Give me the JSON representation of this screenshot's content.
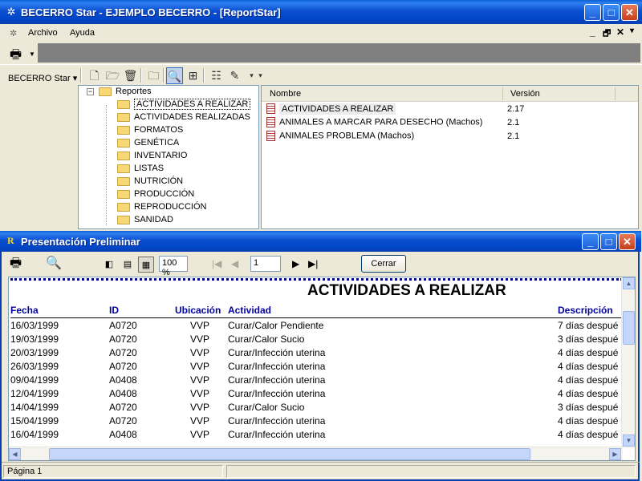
{
  "main_window": {
    "title": "BECERRO Star - EJEMPLO BECERRO - [ReportStar]",
    "controls": {
      "minimize": "_",
      "maximize": "□",
      "close": "✕"
    },
    "menu": [
      "Archivo",
      "Ayuda"
    ],
    "mdi_controls": {
      "minimize": "_",
      "restore": "🗗",
      "close": "✕",
      "dropdown": "▾"
    }
  },
  "toolbar": {
    "becerro_label": "BECERRO Star",
    "icons": [
      "new-icon",
      "open-folder-icon",
      "delete-icon",
      "new-folder-icon",
      "preview-icon",
      "design-icon",
      "properties-icon",
      "wizard-icon"
    ]
  },
  "tree": {
    "root": "Reportes",
    "folders": [
      "ACTIVIDADES A REALIZAR",
      "ACTIVIDADES REALIZADAS",
      "FORMATOS",
      "GENÉTICA",
      "INVENTARIO",
      "LISTAS",
      "NUTRICIÓN",
      "PRODUCCIÓN",
      "REPRODUCCIÓN",
      "SANIDAD"
    ],
    "selected_index": 0
  },
  "list": {
    "headers": {
      "name": "Nombre",
      "version": "Versión"
    },
    "rows": [
      {
        "name": "ACTIVIDADES A REALIZAR",
        "version": "2.17"
      },
      {
        "name": "ANIMALES A MARCAR PARA DESECHO (Machos)",
        "version": "2.1"
      },
      {
        "name": "ANIMALES PROBLEMA (Machos)",
        "version": "2.1"
      }
    ]
  },
  "preview": {
    "title": "Presentación Preliminar",
    "zoom": "100 %",
    "page": "1",
    "close_label": "Cerrar",
    "report_title": "ACTIVIDADES A REALIZAR",
    "columns": {
      "fecha": "Fecha",
      "id": "ID",
      "ubicacion": "Ubicación",
      "actividad": "Actividad",
      "descripcion": "Descripción"
    },
    "rows": [
      {
        "fecha": "16/03/1999",
        "id": "A0720",
        "ubicacion": "VVP",
        "actividad": "Curar/Calor Pendiente",
        "descripcion": "7 días despué"
      },
      {
        "fecha": "19/03/1999",
        "id": "A0720",
        "ubicacion": "VVP",
        "actividad": "Curar/Calor Sucio",
        "descripcion": "3 días despué"
      },
      {
        "fecha": "20/03/1999",
        "id": "A0720",
        "ubicacion": "VVP",
        "actividad": "Curar/Infección uterina",
        "descripcion": "4 días despué"
      },
      {
        "fecha": "26/03/1999",
        "id": "A0720",
        "ubicacion": "VVP",
        "actividad": "Curar/Infección uterina",
        "descripcion": "4 días despué"
      },
      {
        "fecha": "09/04/1999",
        "id": "A0408",
        "ubicacion": "VVP",
        "actividad": "Curar/Infección uterina",
        "descripcion": "4 días despué"
      },
      {
        "fecha": "12/04/1999",
        "id": "A0408",
        "ubicacion": "VVP",
        "actividad": "Curar/Infección uterina",
        "descripcion": "4 días despué"
      },
      {
        "fecha": "14/04/1999",
        "id": "A0720",
        "ubicacion": "VVP",
        "actividad": "Curar/Calor Sucio",
        "descripcion": "3 días despué"
      },
      {
        "fecha": "15/04/1999",
        "id": "A0720",
        "ubicacion": "VVP",
        "actividad": "Curar/Infección uterina",
        "descripcion": "4 días despué"
      },
      {
        "fecha": "16/04/1999",
        "id": "A0408",
        "ubicacion": "VVP",
        "actividad": "Curar/Infección uterina",
        "descripcion": "4 días despué"
      }
    ],
    "status": "Página 1"
  },
  "colors": {
    "title_bar": "#0046c8",
    "column_header": "#0000a0",
    "desktop": "#ece9d8"
  }
}
